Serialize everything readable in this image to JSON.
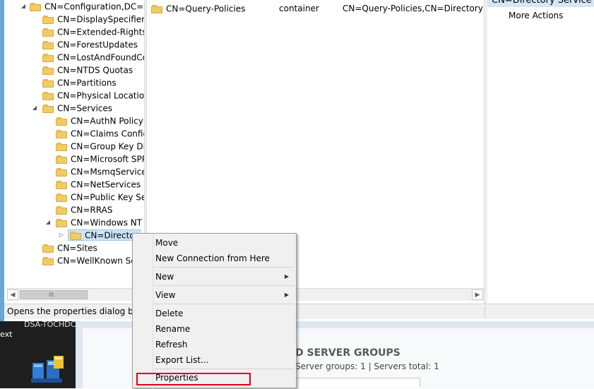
{
  "tree": {
    "items": [
      {
        "label": "CN=Configuration,DC=Wi",
        "expander": "◢"
      },
      {
        "label": "CN=DisplaySpecifiers",
        "expander": ""
      },
      {
        "label": "CN=Extended-Rights",
        "expander": ""
      },
      {
        "label": "CN=ForestUpdates",
        "expander": ""
      },
      {
        "label": "CN=LostAndFoundCor",
        "expander": ""
      },
      {
        "label": "CN=NTDS Quotas",
        "expander": ""
      },
      {
        "label": "CN=Partitions",
        "expander": ""
      },
      {
        "label": "CN=Physical Locations",
        "expander": ""
      },
      {
        "label": "CN=Services",
        "expander": "◢"
      },
      {
        "label": "CN=AuthN Policy C",
        "expander": ""
      },
      {
        "label": "CN=Claims Configu",
        "expander": ""
      },
      {
        "label": "CN=Group Key Dist",
        "expander": ""
      },
      {
        "label": "CN=Microsoft SPP",
        "expander": ""
      },
      {
        "label": "CN=MsmqServices",
        "expander": ""
      },
      {
        "label": "CN=NetServices",
        "expander": ""
      },
      {
        "label": "CN=Public Key Serv",
        "expander": ""
      },
      {
        "label": "CN=RRAS",
        "expander": ""
      },
      {
        "label": "CN=Windows NT",
        "expander": "◢"
      },
      {
        "label": "CN=Director",
        "expander": "▷"
      },
      {
        "label": "CN=Sites",
        "expander": ""
      },
      {
        "label": "CN=WellKnown Sec",
        "expander": ""
      }
    ]
  },
  "list": {
    "rows": [
      {
        "name": "CN=Query-Policies",
        "type": "container",
        "dn": "CN=Query-Policies,CN=Directory Ser"
      }
    ]
  },
  "actions": {
    "header": "CN=Directory Service",
    "more_actions": "More Actions"
  },
  "scrollbar": {
    "left_arrow": "◀",
    "right_arrow": "▶",
    "grip": "III"
  },
  "status": {
    "text": "Opens the properties dialog box f"
  },
  "desktop": {
    "text1": "DSA-TOCHDC",
    "text2": "ext"
  },
  "server_manager": {
    "title": "D SERVER GROUPS",
    "subtitle": "Server groups: 1  |  Servers total: 1"
  },
  "context_menu": {
    "items": [
      {
        "label": "Move",
        "submenu": false
      },
      {
        "label": "New Connection from Here",
        "submenu": false
      },
      {
        "label": "New",
        "submenu": true
      },
      {
        "label": "View",
        "submenu": true
      },
      {
        "label": "Delete",
        "submenu": false
      },
      {
        "label": "Rename",
        "submenu": false
      },
      {
        "label": "Refresh",
        "submenu": false
      },
      {
        "label": "Export List...",
        "submenu": false
      },
      {
        "label": "Properties",
        "submenu": false
      }
    ],
    "submenu_arrow": "▶"
  },
  "colors": {
    "highlight": "#e0001b",
    "selection": "#cce4f7",
    "folder": "#f1cb66"
  }
}
